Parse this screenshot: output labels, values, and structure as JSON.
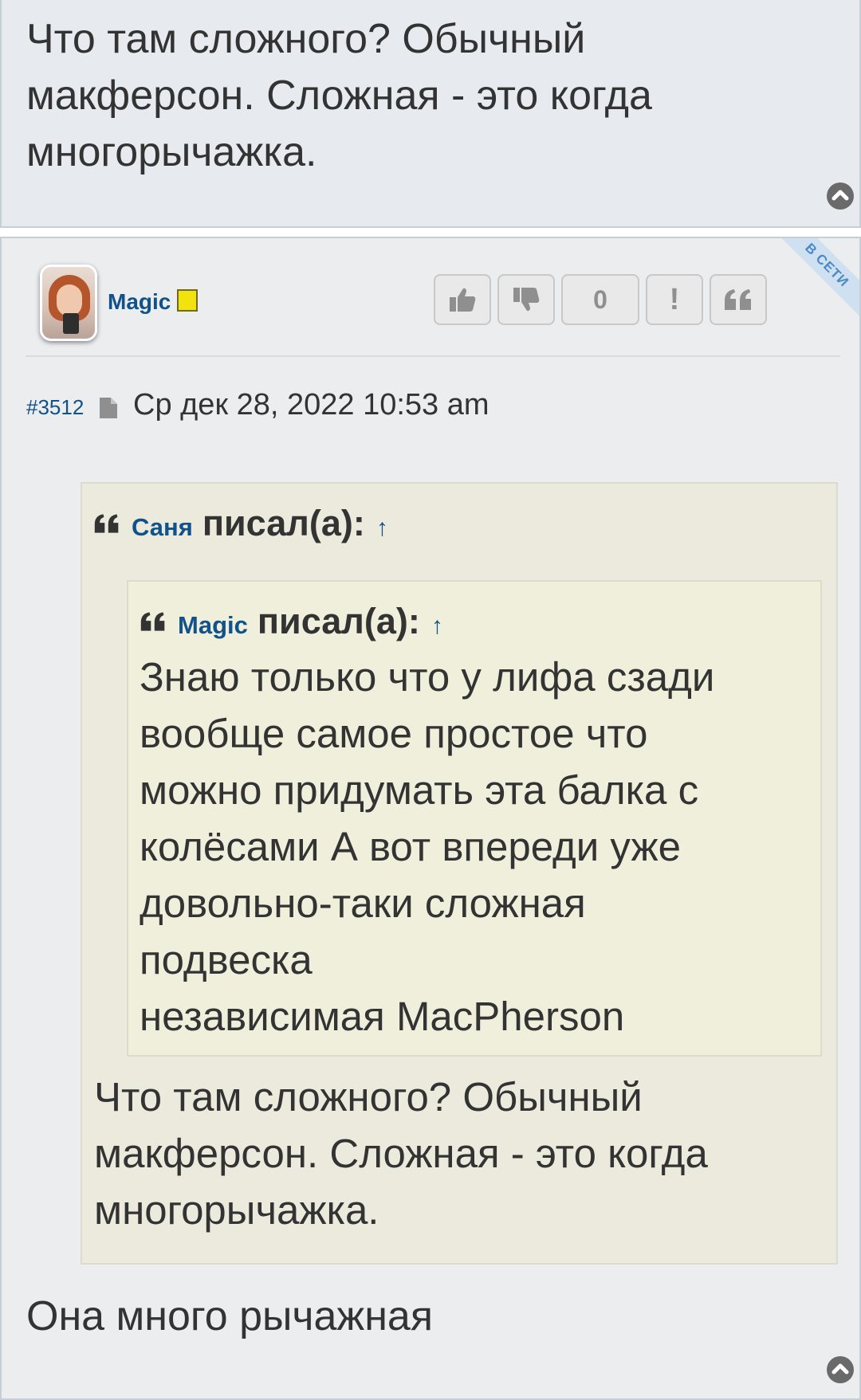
{
  "previous_post": {
    "text": "Что там сложного? Обычный макферсон. Сложная - это когда многорычажка."
  },
  "post": {
    "ribbon": "В СЕТИ",
    "author": "Magic",
    "vote_count": "0",
    "report_label": "!",
    "post_number": "#3512",
    "date": "Ср дек 28, 2022 10:53 am",
    "quote": {
      "author": "Саня",
      "wrote_label": "писал(а):",
      "arrow": "↑",
      "nested": {
        "author": "Magic",
        "wrote_label": "писал(а):",
        "arrow": "↑",
        "text_lines": [
          "Знаю только что у лифа сзади",
          "вообще самое простое что",
          "можно придумать эта балка с",
          "колёсами А вот впереди уже",
          "довольно-таки сложная",
          "подвеска",
          "независимая MacPherson"
        ]
      },
      "text": "Что там сложного? Обычный макферсон. Сложная - это когда многорычажка."
    },
    "text": "Она много рычажная"
  },
  "icons": {
    "scroll_top": "chevron-up-circle-icon",
    "like": "thumbs-up-icon",
    "dislike": "thumbs-down-icon",
    "quote": "quote-icon",
    "post_link": "document-icon",
    "status": "yellow-square-icon"
  },
  "colors": {
    "link": "#105289",
    "text": "#333333",
    "post_bg": "#ecedef",
    "quote_bg": "#ebeadd",
    "status_yellow": "#f2e30f"
  }
}
